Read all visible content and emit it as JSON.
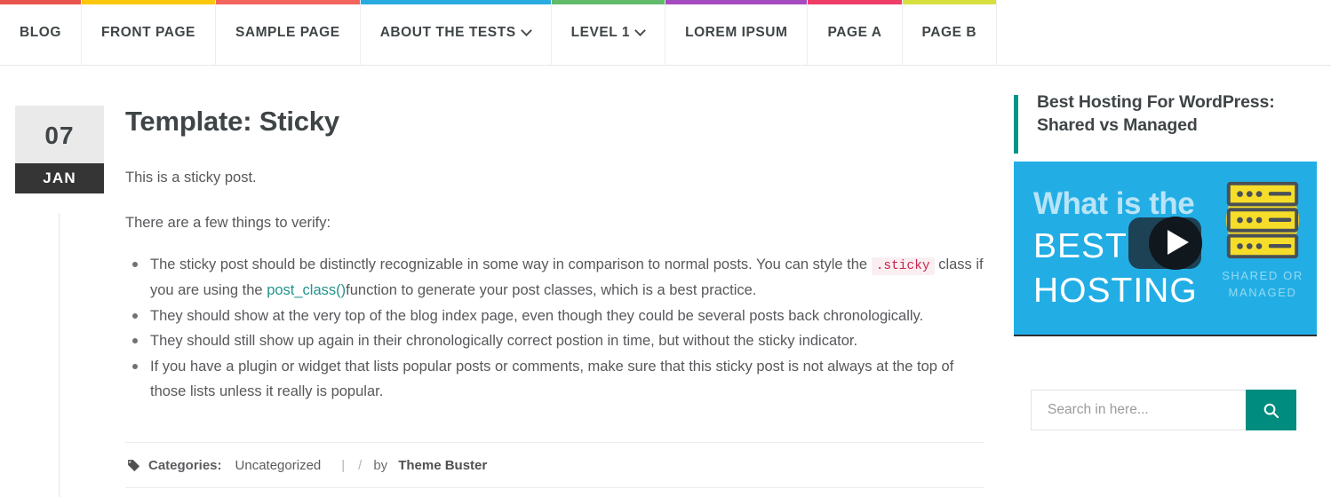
{
  "nav": {
    "items": [
      {
        "label": "BLOG",
        "color": "#e8544b",
        "has_caret": false
      },
      {
        "label": "FRONT PAGE",
        "color": "#fdc70c",
        "has_caret": false
      },
      {
        "label": "SAMPLE PAGE",
        "color": "#f4645f",
        "has_caret": false
      },
      {
        "label": "ABOUT THE TESTS",
        "color": "#29abe2",
        "has_caret": true
      },
      {
        "label": "LEVEL 1",
        "color": "#62bb6a",
        "has_caret": true
      },
      {
        "label": "LOREM IPSUM",
        "color": "#a64bbf",
        "has_caret": false
      },
      {
        "label": "PAGE A",
        "color": "#ee3d67",
        "has_caret": false
      },
      {
        "label": "PAGE B",
        "color": "#d7df3f",
        "has_caret": false
      }
    ]
  },
  "post": {
    "date": {
      "day": "07",
      "month": "JAN"
    },
    "title": "Template: Sticky",
    "paragraphs": [
      "This is a sticky post.",
      "There are a few things to verify:"
    ],
    "list": {
      "item1_a": "The sticky post should be distinctly recognizable in some way in comparison to normal posts. You can style the",
      "item1_code": ".sticky",
      "item1_b": "class if you are using the",
      "item1_link": "post_class()",
      "item1_c": "function to generate your post classes, which is a best practice.",
      "item2": "They should show at the very top of the blog index page, even though they could be several posts back chronologically.",
      "item3": "They should still show up again in their chronologically correct postion in time, but without the sticky indicator.",
      "item4": "If you have a plugin or widget that lists popular posts or comments, make sure that this sticky post is not always at the top of those lists unless it really is popular."
    },
    "meta": {
      "icon": "tag-icon",
      "categories_label": "Categories:",
      "category": "Uncategorized",
      "separator": "|",
      "slash": "/",
      "by": "by",
      "author": "Theme Buster"
    }
  },
  "sidebar": {
    "widget_title": "Best Hosting For WordPress: Shared vs Managed",
    "accent_color": "#00968a",
    "video": {
      "line1": "What is the",
      "line2": "BEST",
      "line3": "HOSTING",
      "sub": "SHARED OR MANAGED",
      "play_icon": "play-icon",
      "bg_color": "#22aee5",
      "server_color": "#f6dd2a"
    },
    "search": {
      "placeholder": "Search in here...",
      "value": "",
      "button_icon": "search-icon",
      "button_color": "#008c7e"
    }
  }
}
